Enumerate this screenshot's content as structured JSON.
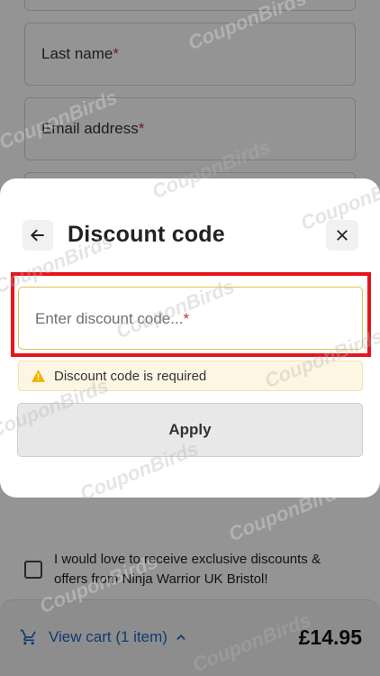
{
  "background_form": {
    "last_name_label": "Last name",
    "email_label": "Email address",
    "required_mark": "*"
  },
  "modal": {
    "title": "Discount code",
    "input_placeholder": "Enter discount code...",
    "required_mark": "*",
    "warning_text": "Discount code is required",
    "apply_label": "Apply"
  },
  "consent": {
    "text": "I would love to receive exclusive discounts & offers from Ninja Warrior UK Bristol!"
  },
  "cart": {
    "link_text": "View cart (1 item)",
    "price": "£14.95"
  },
  "watermark": "CouponBirds",
  "colors": {
    "link": "#1a66c4",
    "highlight": "#e8141b",
    "warning_icon": "#f0b400"
  }
}
